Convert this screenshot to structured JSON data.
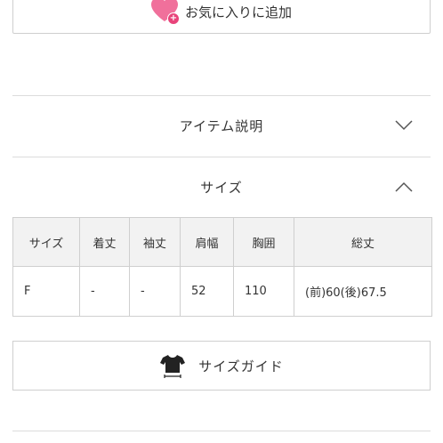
{
  "favorite": {
    "label": "お気に入りに追加",
    "heart_color": "#f0709b",
    "plus_color": "#e8437a"
  },
  "accordions": [
    {
      "label": "アイテム説明",
      "state": "collapsed",
      "icon": "chevron-down-icon"
    },
    {
      "label": "サイズ",
      "state": "expanded",
      "icon": "chevron-up-icon"
    }
  ],
  "size_table": {
    "headers": [
      "サイズ",
      "着丈",
      "袖丈",
      "肩幅",
      "胸囲",
      "総丈"
    ],
    "rows": [
      [
        "F",
        "-",
        "-",
        "52",
        "110",
        "(前)60(後)67.5"
      ]
    ]
  },
  "size_guide": {
    "label": "サイズガイド",
    "icon": "tshirt-icon"
  }
}
